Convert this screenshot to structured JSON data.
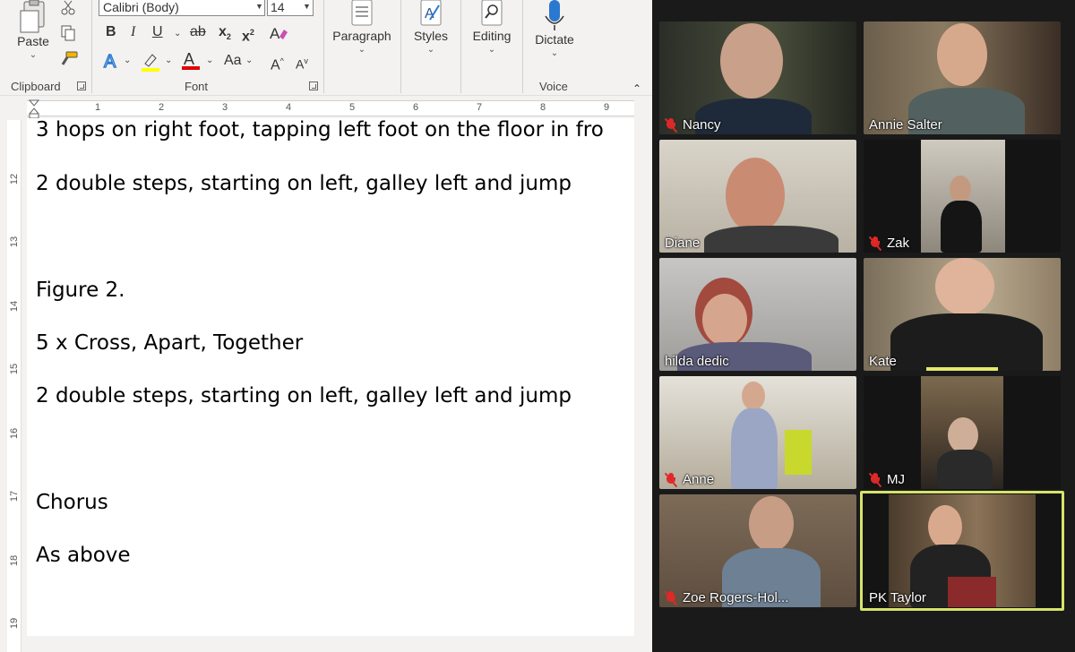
{
  "ribbon": {
    "clipboard": {
      "paste_label": "Paste",
      "group_label": "Clipboard"
    },
    "font": {
      "font_name": "Calibri (Body)",
      "font_size": "14",
      "bold": "B",
      "italic": "I",
      "underline": "U",
      "strikethrough": "ab",
      "subscript": "x",
      "superscript": "x",
      "font_color_letter": "A",
      "change_case": "Aa",
      "grow_font": "A",
      "shrink_font": "A",
      "group_label": "Font"
    },
    "paragraph": {
      "label": "Paragraph"
    },
    "styles": {
      "label": "Styles"
    },
    "editing": {
      "label": "Editing"
    },
    "voice": {
      "dictate_label": "Dictate",
      "group_label": "Voice"
    },
    "accent_colors": {
      "highlight": "#ffff00",
      "font_color": "#e00000",
      "text_effects": "#2b78d0"
    }
  },
  "ruler": {
    "horizontal_numbers": [
      "1",
      "2",
      "3",
      "4",
      "5",
      "6",
      "7",
      "8",
      "9"
    ],
    "vertical_numbers": [
      "12",
      "13",
      "14",
      "15",
      "16",
      "17",
      "18",
      "19"
    ]
  },
  "document": {
    "lines": [
      "3 hops on right foot, tapping left foot on the floor in fro",
      "2 double steps, starting on left, galley left and jump",
      "Figure 2.",
      "5 x Cross, Apart, Together",
      "2 double steps, starting on left, galley left and jump",
      "Chorus",
      "As above"
    ]
  },
  "zoom": {
    "participants": [
      {
        "name": "Nancy",
        "muted": true
      },
      {
        "name": "Annie Salter",
        "muted": false
      },
      {
        "name": "Diane",
        "muted": false
      },
      {
        "name": "Zak",
        "muted": true
      },
      {
        "name": "hilda dedic",
        "muted": false
      },
      {
        "name": "Kate",
        "muted": false
      },
      {
        "name": "Anne",
        "muted": true
      },
      {
        "name": "MJ",
        "muted": true
      },
      {
        "name": "Zoe Rogers-Hol...",
        "muted": true
      },
      {
        "name": "PK Taylor",
        "muted": false,
        "active_speaker": true
      }
    ],
    "colors": {
      "active_speaker_border": "#d6e36a",
      "muted_icon": "#e02828"
    }
  }
}
